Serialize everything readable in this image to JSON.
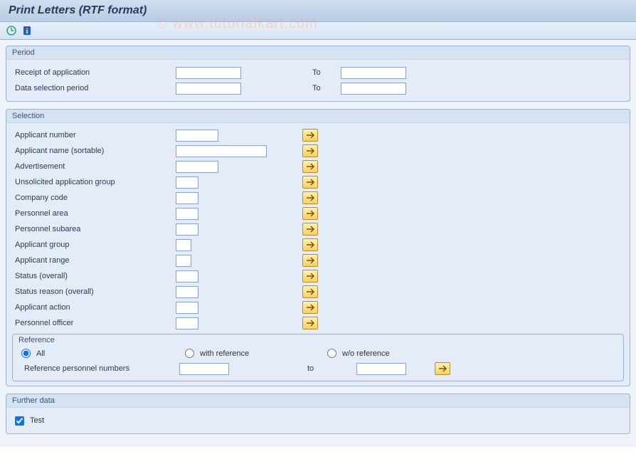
{
  "header": {
    "title": "Print Letters (RTF format)"
  },
  "watermark": "© www.tutorialkart.com",
  "period": {
    "title": "Period",
    "receipt_label": "Receipt of application",
    "data_sel_label": "Data selection period",
    "to_label": "To",
    "receipt_from": "",
    "receipt_to": "",
    "data_from": "",
    "data_to": ""
  },
  "selection": {
    "title": "Selection",
    "rows": [
      {
        "label": "Applicant number",
        "width": "sm"
      },
      {
        "label": "Applicant name (sortable)",
        "width": "lg"
      },
      {
        "label": "Advertisement",
        "width": "sm"
      },
      {
        "label": "Unsolicited application group",
        "width": "xs"
      },
      {
        "label": "Company code",
        "width": "xs"
      },
      {
        "label": "Personnel area",
        "width": "xs"
      },
      {
        "label": "Personnel subarea",
        "width": "xs"
      },
      {
        "label": "Applicant group",
        "width": "tiny"
      },
      {
        "label": "Applicant range",
        "width": "tiny"
      },
      {
        "label": "Status (overall)",
        "width": "xs"
      },
      {
        "label": "Status reason (overall)",
        "width": "xs"
      },
      {
        "label": "Applicant action",
        "width": "xs"
      },
      {
        "label": "Personnel officer",
        "width": "xs"
      }
    ]
  },
  "reference": {
    "title": "Reference",
    "opt_all": "All",
    "opt_with": "with reference",
    "opt_without": "w/o reference",
    "ref_label": "Reference personnel numbers",
    "to_label": "to",
    "from": "",
    "to": ""
  },
  "further": {
    "title": "Further data",
    "test_label": "Test",
    "test_checked": true
  }
}
